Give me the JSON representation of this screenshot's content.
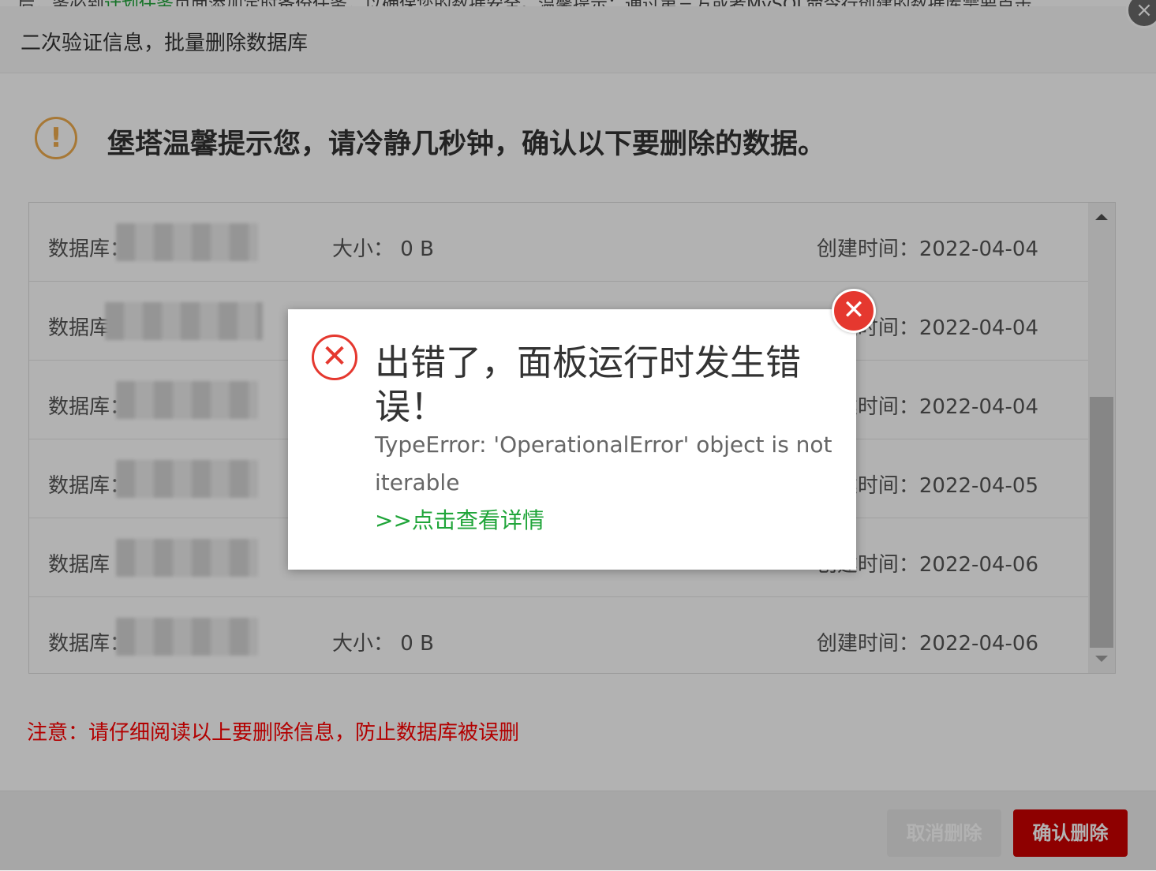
{
  "background_text": {
    "before": "…后，务必到",
    "link": "计划任务",
    "after": "页面添加定时备份任务，以确保您的数据安全。温馨提示：通过第三方或者MySQL命令行创建的数据库需要点击"
  },
  "dialog": {
    "title": "二次验证信息，批量删除数据库",
    "close_icon": "×",
    "warning_icon": "!",
    "warning_text": "堡塔温馨提示您，请冷静几秒钟，确认以下要删除的数据。",
    "rows": [
      {
        "name": "数据库：           m",
        "size": "大小：  0 B",
        "created": "创建时间：2022-04-04"
      },
      {
        "name": "数据库",
        "size": "",
        "created": "创建时间：2022-04-04"
      },
      {
        "name": "数据库：                 om",
        "size": "",
        "created": "创建时间：2022-04-04"
      },
      {
        "name": "数据库：                 om",
        "size": "",
        "created": "创建时间：2022-04-05"
      },
      {
        "name": "数据库",
        "size": "",
        "created": "创建时间：2022-04-06"
      },
      {
        "name": "数据库：              m",
        "size": "大小：  0 B",
        "created": "创建时间：2022-04-06"
      }
    ],
    "note": "注意：请仔细阅读以上要删除信息，防止数据库被误删",
    "cancel_label": "取消删除",
    "confirm_label": "确认删除"
  },
  "error_popup": {
    "icon": "✕",
    "title": "出错了，面板运行时发生错误！",
    "message": "TypeError: 'OperationalError' object is not iterable",
    "link": ">>点击查看详情",
    "close_icon": "✕"
  },
  "colors": {
    "accent_green": "#20a53a",
    "danger_red": "#cc0000",
    "warning_orange": "#f0ad4e",
    "error_red": "#e5382f"
  }
}
